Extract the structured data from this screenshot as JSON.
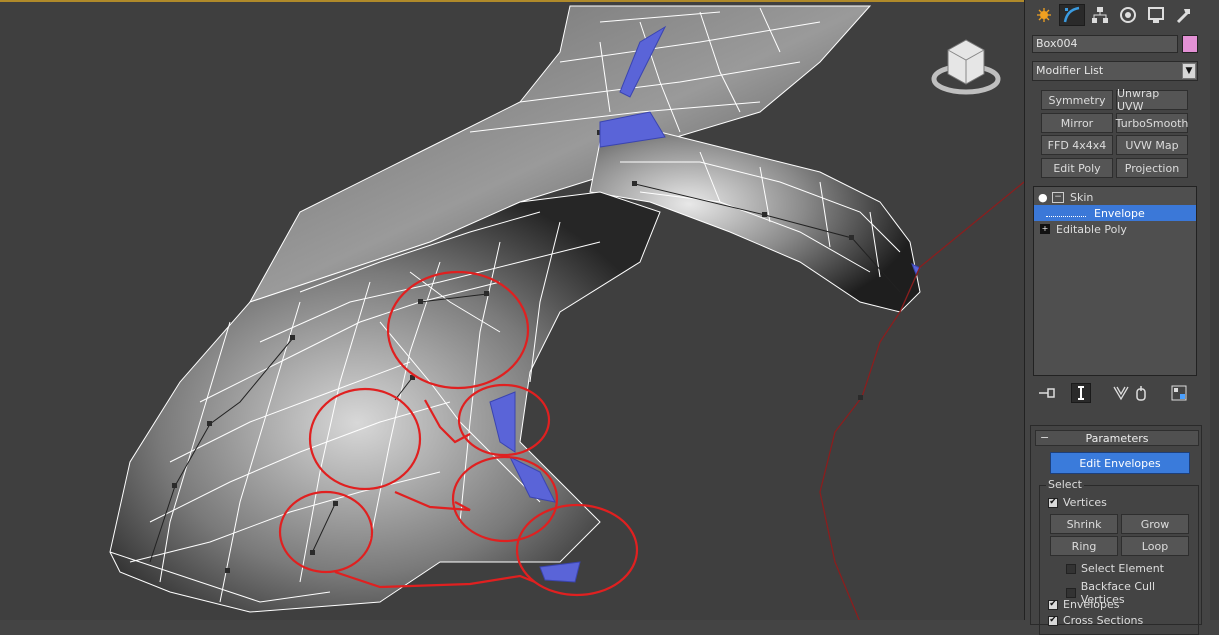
{
  "command_panel": {
    "tabs": [
      "create-icon",
      "modify-icon",
      "hierarchy-icon",
      "motion-icon",
      "display-icon",
      "utilities-icon"
    ],
    "object_name": "Box004",
    "object_color": "#e391d5",
    "modifier_list_label": "Modifier List",
    "modifier_buttons": [
      "Symmetry",
      "Unwrap UVW",
      "Mirror",
      "TurboSmooth",
      "FFD 4x4x4",
      "UVW Map",
      "Edit Poly",
      "Projection"
    ],
    "stack": [
      {
        "label": "Skin",
        "kind": "modifier",
        "expanded": true
      },
      {
        "label": "Envelope",
        "kind": "sub-object",
        "selected": true
      },
      {
        "label": "Editable Poly",
        "kind": "base-object",
        "expanded": false
      }
    ],
    "stack_icons": [
      "pin-stack-icon",
      "show-end-result-icon",
      "make-unique-icon",
      "remove-modifier-icon",
      "configure-modifier-sets-icon"
    ],
    "parameters": {
      "title": "Parameters",
      "edit_envelopes_label": "Edit Envelopes",
      "select_group_label": "Select",
      "vertices": {
        "label": "Vertices",
        "checked": true
      },
      "buttons": [
        "Shrink",
        "Grow",
        "Ring",
        "Loop"
      ],
      "select_element": {
        "label": "Select Element",
        "checked": false
      },
      "backface_cull": {
        "label": "Backface Cull Vertices",
        "checked": false
      },
      "envelopes": {
        "label": "Envelopes",
        "checked": true
      },
      "cross_sections": {
        "label": "Cross Sections",
        "checked": true
      }
    }
  },
  "colors": {
    "viewport_bg": "#3f3f3f",
    "active_border": "#b08a2a",
    "selection_blue": "#3b78d8",
    "annotation_red": "#e02020",
    "envelope_blue": "#5a64d8"
  }
}
